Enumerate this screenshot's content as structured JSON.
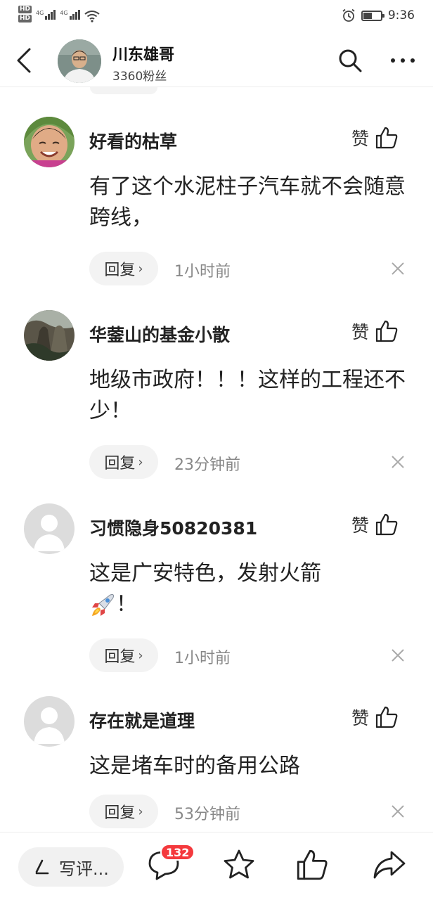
{
  "status_bar": {
    "hd1": "HD",
    "hd2": "HD",
    "net1": "4G",
    "net2": "4G",
    "battery_level": 0.5,
    "time": "9:36"
  },
  "header": {
    "name": "川东雄哥",
    "fans": "3360粉丝"
  },
  "comments": [
    {
      "username": "好看的枯草",
      "like_label": "赞",
      "text": "有了这个水泥柱子汽车就不会随意跨线，",
      "reply_label": "回复",
      "time": "1小时前"
    },
    {
      "username": "华蓥山的基金小散",
      "like_label": "赞",
      "text": "地级市政府！！！这样的工程还不少！",
      "reply_label": "回复",
      "time": "23分钟前"
    },
    {
      "username": "习惯隐身50820381",
      "like_label": "赞",
      "text": "这是广安特色，发射火箭",
      "text_after_emoji": "！",
      "reply_label": "回复",
      "time": "1小时前"
    },
    {
      "username": "存在就是道理",
      "like_label": "赞",
      "text": "这是堵车时的备用公路",
      "reply_label": "回复",
      "time": "53分钟前"
    }
  ],
  "bottom_bar": {
    "write_label": "写评...",
    "comment_count": "132"
  }
}
